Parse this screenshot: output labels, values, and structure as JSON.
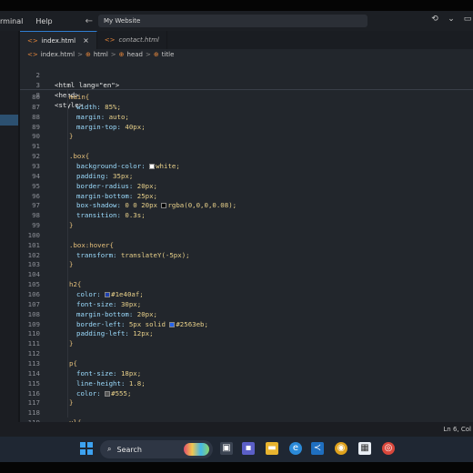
{
  "titlebar": {
    "menus": [
      "rminal",
      "Help"
    ],
    "command_center": "My Website",
    "back_arrow": "←",
    "forward_arrow": "→"
  },
  "tabs": [
    {
      "label": "index.html",
      "icon": "html-file-icon",
      "active": true,
      "close": "×"
    },
    {
      "label": "contact.html",
      "icon": "html-file-icon",
      "active": false
    }
  ],
  "breadcrumb": {
    "items": [
      "index.html",
      "html",
      "head",
      "title"
    ],
    "separator": ">"
  },
  "sticky_lines": [
    {
      "n": "2",
      "text": "<html lang=\"en\">"
    },
    {
      "n": "3",
      "text": "<head>"
    },
    {
      "n": "8",
      "text": "<style>"
    }
  ],
  "code_lines": [
    {
      "n": "86",
      "indent": 2,
      "parts": [
        [
          "sel",
          "main{"
        ]
      ]
    },
    {
      "n": "87",
      "indent": 3,
      "parts": [
        [
          "prop",
          "width: "
        ],
        [
          "val",
          "85%;"
        ]
      ]
    },
    {
      "n": "88",
      "indent": 3,
      "parts": [
        [
          "prop",
          "margin: "
        ],
        [
          "val",
          "auto;"
        ]
      ]
    },
    {
      "n": "89",
      "indent": 3,
      "parts": [
        [
          "prop",
          "margin-top: "
        ],
        [
          "val",
          "40px;"
        ]
      ]
    },
    {
      "n": "90",
      "indent": 2,
      "parts": [
        [
          "brace",
          "}"
        ]
      ]
    },
    {
      "n": "91",
      "indent": 0,
      "parts": []
    },
    {
      "n": "92",
      "indent": 2,
      "parts": [
        [
          "sel",
          ".box{"
        ]
      ]
    },
    {
      "n": "93",
      "indent": 3,
      "parts": [
        [
          "prop",
          "background-color: "
        ],
        [
          "swatch",
          "#ffffff"
        ],
        [
          "val",
          "white;"
        ]
      ]
    },
    {
      "n": "94",
      "indent": 3,
      "parts": [
        [
          "prop",
          "padding: "
        ],
        [
          "val",
          "35px;"
        ]
      ]
    },
    {
      "n": "95",
      "indent": 3,
      "parts": [
        [
          "prop",
          "border-radius: "
        ],
        [
          "val",
          "20px;"
        ]
      ]
    },
    {
      "n": "96",
      "indent": 3,
      "parts": [
        [
          "prop",
          "margin-bottom: "
        ],
        [
          "val",
          "25px;"
        ]
      ]
    },
    {
      "n": "97",
      "indent": 3,
      "parts": [
        [
          "prop",
          "box-shadow: "
        ],
        [
          "val",
          "0 0 20px "
        ],
        [
          "swatch",
          "#000000"
        ],
        [
          "val",
          "rgba(0,0,0,0.08);"
        ]
      ]
    },
    {
      "n": "98",
      "indent": 3,
      "parts": [
        [
          "prop",
          "transition: "
        ],
        [
          "val",
          "0.3s;"
        ]
      ]
    },
    {
      "n": "99",
      "indent": 2,
      "parts": [
        [
          "brace",
          "}"
        ]
      ]
    },
    {
      "n": "100",
      "indent": 0,
      "parts": []
    },
    {
      "n": "101",
      "indent": 2,
      "parts": [
        [
          "sel",
          ".box:hover{"
        ]
      ]
    },
    {
      "n": "102",
      "indent": 3,
      "parts": [
        [
          "prop",
          "transform: "
        ],
        [
          "val",
          "translateY(-5px);"
        ]
      ]
    },
    {
      "n": "103",
      "indent": 2,
      "parts": [
        [
          "brace",
          "}"
        ]
      ]
    },
    {
      "n": "104",
      "indent": 0,
      "parts": []
    },
    {
      "n": "105",
      "indent": 2,
      "parts": [
        [
          "sel",
          "h2{"
        ]
      ]
    },
    {
      "n": "106",
      "indent": 3,
      "parts": [
        [
          "prop",
          "color: "
        ],
        [
          "swatch",
          "#1e40af"
        ],
        [
          "val",
          "#1e40af;"
        ]
      ]
    },
    {
      "n": "107",
      "indent": 3,
      "parts": [
        [
          "prop",
          "font-size: "
        ],
        [
          "val",
          "30px;"
        ]
      ]
    },
    {
      "n": "108",
      "indent": 3,
      "parts": [
        [
          "prop",
          "margin-bottom: "
        ],
        [
          "val",
          "20px;"
        ]
      ]
    },
    {
      "n": "109",
      "indent": 3,
      "parts": [
        [
          "prop",
          "border-left: "
        ],
        [
          "val",
          "5px solid "
        ],
        [
          "swatch",
          "#2563eb"
        ],
        [
          "val",
          "#2563eb;"
        ]
      ]
    },
    {
      "n": "110",
      "indent": 3,
      "parts": [
        [
          "prop",
          "padding-left: "
        ],
        [
          "val",
          "12px;"
        ]
      ]
    },
    {
      "n": "111",
      "indent": 2,
      "parts": [
        [
          "brace",
          "}"
        ]
      ]
    },
    {
      "n": "112",
      "indent": 0,
      "parts": []
    },
    {
      "n": "113",
      "indent": 2,
      "parts": [
        [
          "sel",
          "p{"
        ]
      ]
    },
    {
      "n": "114",
      "indent": 3,
      "parts": [
        [
          "prop",
          "font-size: "
        ],
        [
          "val",
          "18px;"
        ]
      ]
    },
    {
      "n": "115",
      "indent": 3,
      "parts": [
        [
          "prop",
          "line-height: "
        ],
        [
          "val",
          "1.8;"
        ]
      ]
    },
    {
      "n": "116",
      "indent": 3,
      "parts": [
        [
          "prop",
          "color: "
        ],
        [
          "swatch",
          "#555555"
        ],
        [
          "val",
          "#555;"
        ]
      ]
    },
    {
      "n": "117",
      "indent": 2,
      "parts": [
        [
          "brace",
          "}"
        ]
      ]
    },
    {
      "n": "118",
      "indent": 0,
      "parts": []
    },
    {
      "n": "119",
      "indent": 2,
      "parts": [
        [
          "sel",
          "ul{"
        ]
      ]
    }
  ],
  "statusbar": {
    "position": "Ln 6, Col"
  },
  "taskbar": {
    "search_label": "Search",
    "apps": [
      "task-view-icon",
      "teams-icon",
      "file-explorer-icon",
      "edge-icon",
      "vscode-icon",
      "chrome-icon",
      "store-icon",
      "browser-icon"
    ]
  },
  "colors": {
    "editor_bg": "#22262c",
    "accent": "#2f7dd1",
    "selector": "#e6c07b",
    "property": "#9cdcfe",
    "value": "#e8d08a"
  }
}
